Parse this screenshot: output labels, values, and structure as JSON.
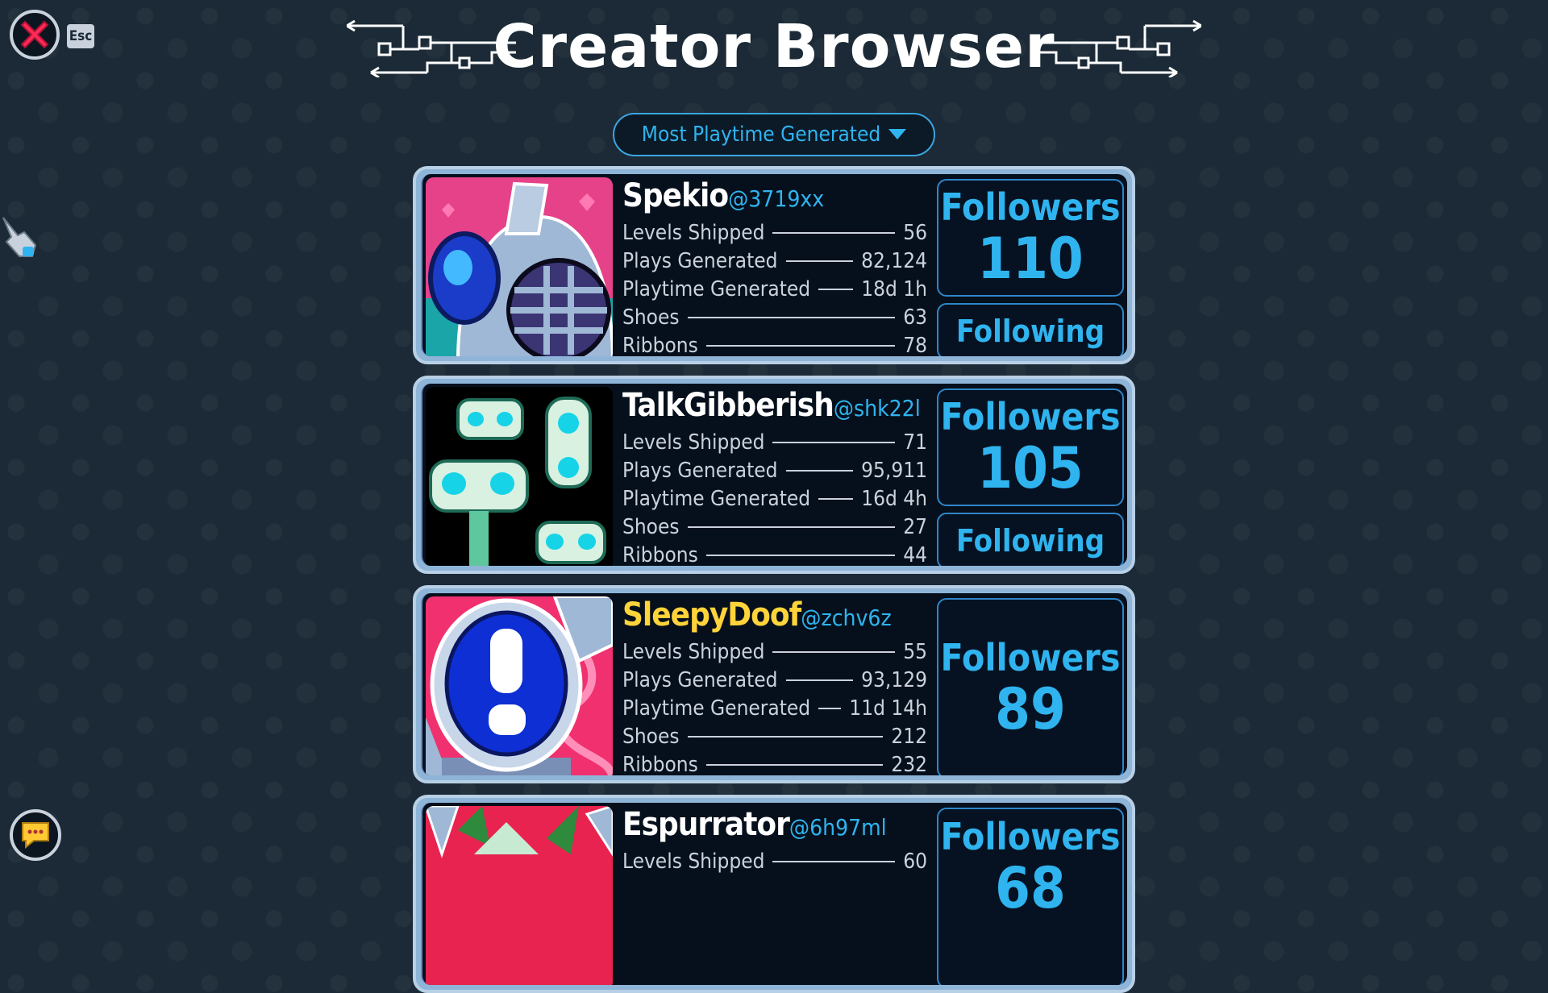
{
  "header": {
    "title": "Creator Browser",
    "esc_label": "Esc"
  },
  "sort": {
    "selected": "Most Playtime Generated"
  },
  "stat_labels": {
    "levels": "Levels Shipped",
    "plays": "Plays Generated",
    "playtime": "Playtime Generated",
    "shoes": "Shoes",
    "ribbons": "Ribbons"
  },
  "followers_label": "Followers",
  "following_label": "Following",
  "creators": [
    {
      "name": "Spekio",
      "handle": "@3719xx",
      "levels": "56",
      "plays": "82,124",
      "playtime": "18d 1h",
      "shoes": "63",
      "ribbons": "78",
      "followers": "110",
      "following": true,
      "name_color": "#ffffff"
    },
    {
      "name": "TalkGibberish",
      "handle": "@shk22l",
      "levels": "71",
      "plays": "95,911",
      "playtime": "16d 4h",
      "shoes": "27",
      "ribbons": "44",
      "followers": "105",
      "following": true,
      "name_color": "#ffffff"
    },
    {
      "name": "SleepyDoof",
      "handle": "@zchv6z",
      "levels": "55",
      "plays": "93,129",
      "playtime": "11d 14h",
      "shoes": "212",
      "ribbons": "232",
      "followers": "89",
      "following": false,
      "name_color": "#ffd43a"
    },
    {
      "name": "Espurrator",
      "handle": "@6h97ml",
      "levels": "60",
      "plays": "",
      "playtime": "",
      "shoes": "",
      "ribbons": "",
      "followers": "68",
      "following": false,
      "name_color": "#ffffff"
    }
  ],
  "colors": {
    "accent": "#2fb4ef",
    "gold": "#ffd43a",
    "background": "#1b2a36"
  }
}
